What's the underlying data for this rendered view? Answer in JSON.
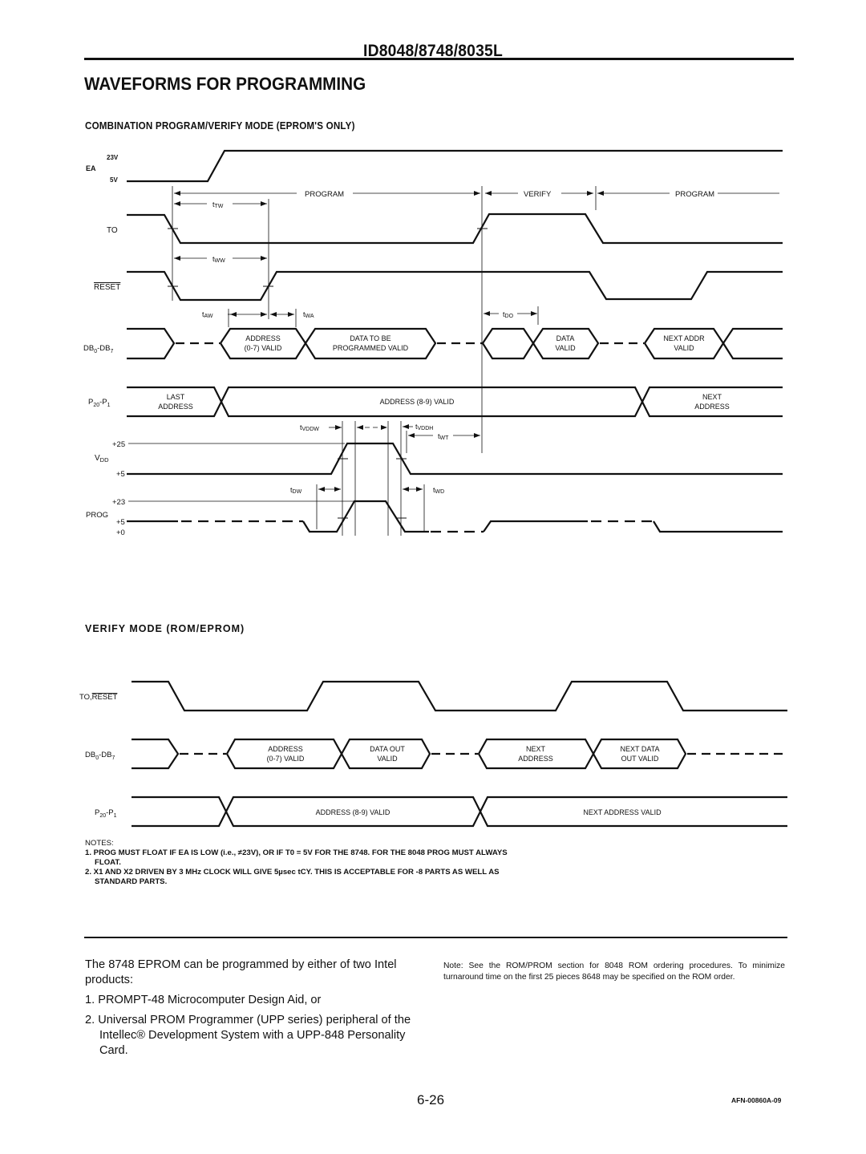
{
  "header": {
    "part_number": "ID8048/8748/8035L",
    "section_title": "WAVEFORMS FOR PROGRAMMING"
  },
  "combination_diagram": {
    "title": "COMBINATION PROGRAM/VERIFY MODE (EPROM'S ONLY)",
    "signals": {
      "ea": {
        "name": "EA",
        "levels": [
          "23V",
          "5V"
        ]
      },
      "to": {
        "name": "TO"
      },
      "reset": {
        "name": "RESET",
        "active_low": true
      },
      "db": {
        "name": "DB0-DB7",
        "base": "DB",
        "sub_start": "0",
        "sep": "-DB",
        "sub_end": "7"
      },
      "p2": {
        "name": "P20-P1",
        "base": "P",
        "sub_start": "20",
        "sep": "-P",
        "sub_end": "1"
      },
      "vdd": {
        "name": "VDD",
        "base": "V",
        "sub": "DD",
        "levels": [
          "+25",
          "+5"
        ]
      },
      "prog": {
        "name": "PROG",
        "levels": [
          "+23",
          "+5",
          "+0"
        ]
      }
    },
    "phases": [
      "PROGRAM",
      "VERIFY",
      "PROGRAM"
    ],
    "timing_labels": {
      "ttw": {
        "t": "t",
        "sub": "TW"
      },
      "tww": {
        "t": "t",
        "sub": "WW"
      },
      "taw": {
        "t": "t",
        "sub": "AW"
      },
      "twa": {
        "t": "t",
        "sub": "WA"
      },
      "tdo": {
        "t": "t",
        "sub": "DO"
      },
      "tvddw": {
        "t": "t",
        "sub": "VDDW"
      },
      "tvddh": {
        "t": "t",
        "sub": "VDDH"
      },
      "twt": {
        "t": "t",
        "sub": "WT"
      },
      "tdw": {
        "t": "t",
        "sub": "DW"
      },
      "twd": {
        "t": "t",
        "sub": "WD"
      }
    },
    "db_windows": [
      [
        "ADDRESS",
        "(0-7) VALID"
      ],
      [
        "DATA TO BE",
        "PROGRAMMED VALID"
      ],
      [
        "DATA",
        "VALID"
      ],
      [
        "NEXT ADDR",
        "VALID"
      ]
    ],
    "p2_windows": [
      [
        "LAST",
        "ADDRESS"
      ],
      [
        "ADDRESS (8-9) VALID"
      ],
      [
        "NEXT",
        "ADDRESS"
      ]
    ]
  },
  "verify_diagram": {
    "title": "VERIFY MODE (ROM/EPROM)",
    "signals": {
      "to_reset": {
        "name_plain": "TO,",
        "name_bar": "RESET"
      },
      "db": {
        "base": "DB",
        "sub_start": "0",
        "sep": "-DB",
        "sub_end": "7"
      },
      "p2": {
        "base": "P",
        "sub_start": "20",
        "sep": "-P",
        "sub_end": "1"
      }
    },
    "db_windows": [
      [
        "ADDRESS",
        "(0-7) VALID"
      ],
      [
        "DATA OUT",
        "VALID"
      ],
      [
        "NEXT",
        "ADDRESS"
      ],
      [
        "NEXT DATA",
        "OUT VALID"
      ]
    ],
    "p2_windows": [
      [
        "ADDRESS (8-9) VALID"
      ],
      [
        "NEXT ADDRESS VALID"
      ]
    ]
  },
  "notes": {
    "header": "NOTES:",
    "items": [
      "1. PROG MUST FLOAT IF EA IS LOW (i.e., ≠23V), OR IF T0 = 5V FOR THE 8748. FOR THE 8048 PROG MUST ALWAYS FLOAT.",
      "2. X1 AND X2 DRIVEN BY 3 MHz CLOCK WILL GIVE 5µsec tCY. THIS IS ACCEPTABLE FOR -8 PARTS AS WELL AS STANDARD PARTS."
    ]
  },
  "body": {
    "intro": "The 8748 EPROM can be programmed by either of two Intel products:",
    "items": [
      "1. PROMPT-48 Microcomputer Design Aid, or",
      "2. Universal PROM Programmer (UPP series) peripheral of the Intellec® Development System with a UPP-848 Personality Card."
    ],
    "side_note": "Note: See the ROM/PROM section for 8048 ROM ordering procedures. To minimize turnaround time on the first 25 pieces 8648 may be specified on the ROM order."
  },
  "footer": {
    "page_number": "6-26",
    "doc_code": "AFN-00860A-09"
  }
}
